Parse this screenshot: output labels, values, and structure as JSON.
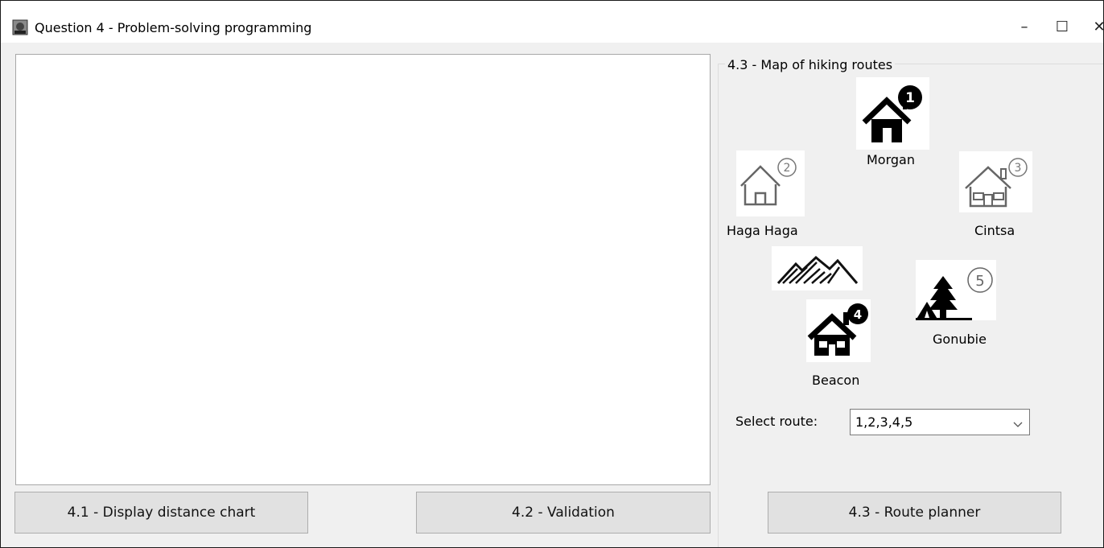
{
  "window": {
    "title": "Question 4 - Problem-solving programming",
    "app_icon": "app-icon",
    "controls": {
      "minimize": "–",
      "maximize": "☐",
      "close": "✕"
    }
  },
  "buttons": {
    "display_chart": "4.1 - Display distance chart",
    "validation": "4.2 - Validation",
    "route_planner": "4.3 - Route planner"
  },
  "map": {
    "group_title": "4.3 - Map of hiking routes",
    "places": {
      "morgan": {
        "name": "Morgan",
        "number": "1",
        "icon": "house-icon"
      },
      "haga_haga": {
        "name": "Haga Haga",
        "number": "2",
        "icon": "house-outline-icon"
      },
      "cintsa": {
        "name": "Cintsa",
        "number": "3",
        "icon": "house-outline-icon"
      },
      "beacon": {
        "name": "Beacon",
        "number": "4",
        "icon": "house-icon"
      },
      "gonubie": {
        "name": "Gonubie",
        "number": "5",
        "icon": "tent-tree-icon"
      }
    },
    "mountains_icon": "mountains-icon"
  },
  "route": {
    "label": "Select route:",
    "selected": "1,2,3,4,5"
  }
}
